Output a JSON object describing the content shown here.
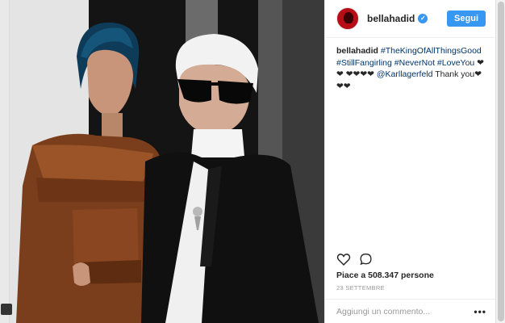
{
  "post": {
    "username": "bellahadid",
    "follow_label": "Segui",
    "caption_user": "bellahadid",
    "caption_tags": [
      "#TheKingOfAllThingsGood",
      "#StillFangirling",
      "#NeverNot",
      "#LoveYou"
    ],
    "caption_hearts_1": "❤❤",
    "caption_hearts_2": "❤❤❤❤",
    "mention": "@Karllagerfeld",
    "caption_end": "Thank you❤❤❤",
    "likes": "Piace a 508.347 persone",
    "date": "23 SETTEMBRE",
    "comment_placeholder": "Aggiungi un commento...",
    "more_label": "•••"
  },
  "icons": {
    "like": "heart-outline-icon",
    "comment": "comment-bubble-icon",
    "verified": "verified-badge-icon"
  },
  "colors": {
    "accent": "#3897f0",
    "avatar_bg": "#b80d16",
    "hashtag": "#003569"
  }
}
